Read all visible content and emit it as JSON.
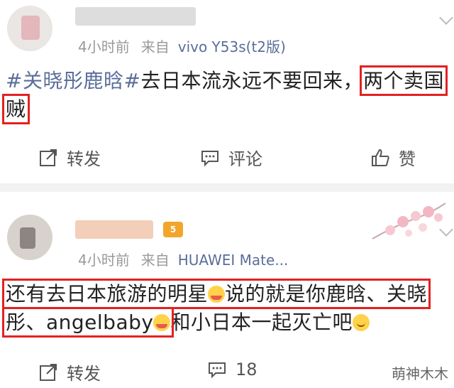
{
  "posts": [
    {
      "time": "4小时前",
      "from_label": "来自",
      "source": "vivo Y53s(t2版)",
      "topic": "#关晓彤鹿晗#",
      "text_a": "去日本流永远不要回来，",
      "text_hl1": "两个卖国",
      "text_hl2": "贼",
      "actions": {
        "repost": "转发",
        "comment": "评论",
        "like": "赞"
      }
    },
    {
      "time": "4小时前",
      "from_label": "来自",
      "source": "HUAWEI Mate...",
      "line1": "还有去日本旅游的明星",
      "line1b": "说的就是你鹿晗、关晓",
      "line2a": "彤、angelbaby",
      "line2b": "和小日本一起灭亡吧",
      "badge": "5",
      "actions": {
        "repost": "转发",
        "comment_count": "18"
      },
      "watermark": "萌神木木"
    }
  ],
  "colors": {
    "link": "#5b6e9a",
    "highlight_box": "#e32121",
    "meta": "#999999"
  },
  "icons": [
    "share-icon",
    "comment-icon",
    "thumbs-up-icon",
    "crying-emoji",
    "smile-emoji",
    "crown-badge",
    "cherry-blossom-decoration"
  ]
}
